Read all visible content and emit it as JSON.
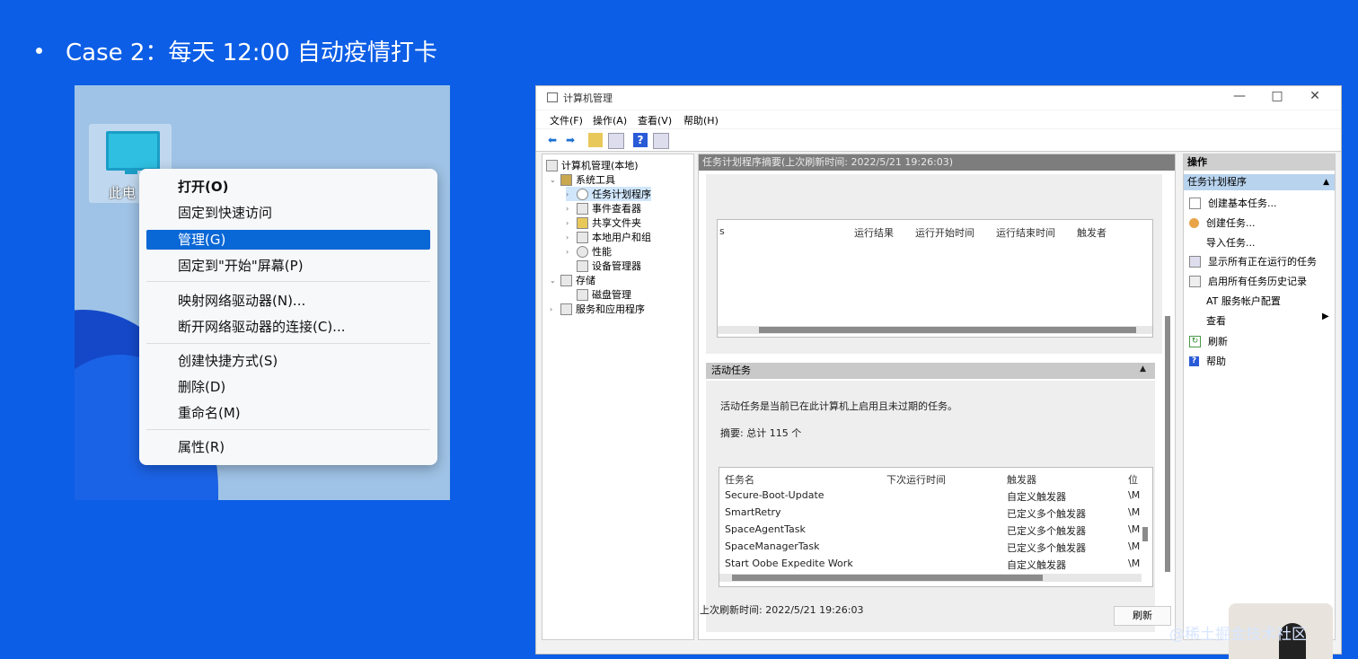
{
  "slide": {
    "title": "Case 2：每天 12:00 自动疫情打卡"
  },
  "desktop": {
    "icon_label": "此电"
  },
  "context_menu": {
    "items": [
      "打开(O)",
      "固定到快速访问",
      "管理(G)",
      "固定到\"开始\"屏幕(P)",
      "映射网络驱动器(N)...",
      "断开网络驱动器的连接(C)...",
      "创建快捷方式(S)",
      "删除(D)",
      "重命名(M)",
      "属性(R)"
    ],
    "selected": "管理(G)"
  },
  "window": {
    "title": "计算机管理",
    "minimize": "—",
    "maximize": "□",
    "close": "✕",
    "menu": [
      "文件(F)",
      "操作(A)",
      "查看(V)",
      "帮助(H)"
    ]
  },
  "tree": {
    "root": "计算机管理(本地)",
    "system_tools": "系统工具",
    "task_scheduler": "任务计划程序",
    "event_viewer": "事件查看器",
    "shared_folders": "共享文件夹",
    "local_users": "本地用户和组",
    "performance": "性能",
    "device_manager": "设备管理器",
    "storage": "存储",
    "disk_management": "磁盘管理",
    "services_apps": "服务和应用程序"
  },
  "center": {
    "header": "任务计划程序摘要(上次刷新时间: 2022/5/21 19:26:03)",
    "status_columns": [
      "s",
      "运行结果",
      "运行开始时间",
      "运行结束时间",
      "触发者"
    ],
    "active_tasks_title": "活动任务",
    "active_tasks_desc": "活动任务是当前已在此计算机上启用且未过期的任务。",
    "summary": "摘要: 总计 115 个",
    "task_columns": [
      "任务名",
      "下次运行时间",
      "触发器",
      "位"
    ],
    "tasks": [
      {
        "name": "Secure-Boot-Update",
        "next": "",
        "trigger": "自定义触发器",
        "loc": "\\M"
      },
      {
        "name": "SmartRetry",
        "next": "",
        "trigger": "已定义多个触发器",
        "loc": "\\M"
      },
      {
        "name": "SpaceAgentTask",
        "next": "",
        "trigger": "已定义多个触发器",
        "loc": "\\M"
      },
      {
        "name": "SpaceManagerTask",
        "next": "",
        "trigger": "已定义多个触发器",
        "loc": "\\M"
      },
      {
        "name": "Start Oobe Expedite Work",
        "next": "",
        "trigger": "自定义触发器",
        "loc": "\\M"
      }
    ],
    "last_refresh": "上次刷新时间: 2022/5/21 19:26:03",
    "refresh_button": "刷新"
  },
  "actions": {
    "header": "操作",
    "section": "任务计划程序",
    "items": [
      "创建基本任务...",
      "创建任务...",
      "导入任务...",
      "显示所有正在运行的任务",
      "启用所有任务历史记录",
      "AT 服务帐户配置",
      "查看",
      "刷新",
      "帮助"
    ]
  },
  "watermark": "@稀土掘金技术社区"
}
